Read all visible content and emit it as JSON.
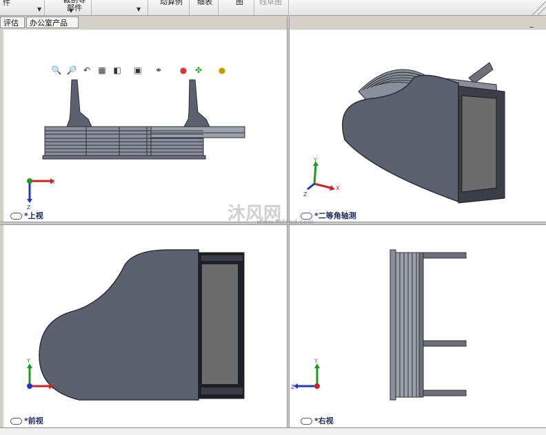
{
  "ribbon": {
    "items": [
      {
        "label": "件"
      },
      {
        "label": "截剖等\n部件"
      },
      {
        "label": ""
      },
      {
        "label": "动算例"
      },
      {
        "label": "细表"
      },
      {
        "label": "图"
      },
      {
        "label": "线草图"
      }
    ]
  },
  "tabs": [
    {
      "label": "评估"
    },
    {
      "label": "办公室产品"
    }
  ],
  "heads_up_toolbar": {
    "icons": [
      "zoom-to-fit-icon",
      "zoom-area-icon",
      "previous-view-icon",
      "section-view-icon",
      "view-orientation-icon",
      "display-style-icon",
      "hide-show-icon",
      "edit-appearance-icon",
      "apply-scene-icon",
      "view-settings-icon"
    ]
  },
  "viewports": [
    {
      "name": "*上视",
      "triad": {
        "h": "X",
        "v": "Z"
      }
    },
    {
      "name": "*二等角轴测",
      "triad": {
        "h": "X",
        "v": "Y",
        "z": "Z"
      }
    },
    {
      "name": "*前视",
      "triad": {
        "h": "X",
        "v": "Y"
      }
    },
    {
      "name": "*右视",
      "triad": {
        "h": "Z",
        "v": "Y"
      }
    }
  ],
  "watermark": {
    "text": "沐风网",
    "sub": "www.mfcad.com"
  },
  "colors": {
    "body": "#5c6170",
    "body_dark": "#3b3e47",
    "glass": "#6c6c6c",
    "bar_red": "#d22020",
    "bar_green": "#1f9a1f",
    "bar_blue": "#2233cc"
  }
}
